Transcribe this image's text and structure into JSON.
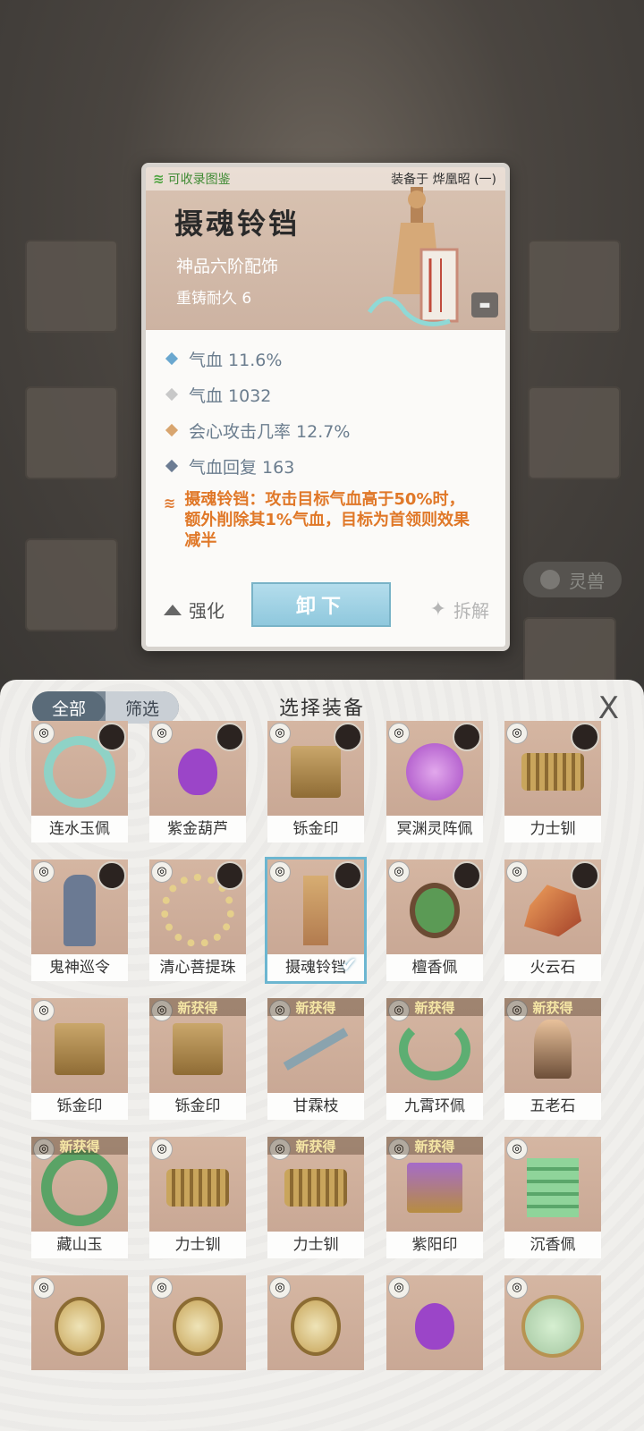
{
  "background": {
    "pill_label": "灵兽"
  },
  "detail": {
    "collect_label": "可收录图鉴",
    "equipped_on": "装备于 烨凰昭 (一)",
    "name": "摄魂铃铛",
    "grade": "神品六阶配饰",
    "durability": "重铸耐久 6",
    "attributes": [
      {
        "text": "气血 11.6%",
        "color": "#6aa7cf"
      },
      {
        "text": "气血 1032",
        "color": "#c8c8c8"
      },
      {
        "text": "会心攻击几率 12.7%",
        "color": "#d8a56f"
      },
      {
        "text": "气血回复 163",
        "color": "#6c7c93"
      }
    ],
    "skill_text": "摄魂铃铛：攻击目标气血高于50%时，额外削除其1%气血，目标为首领则效果减半",
    "strengthen_label": "强化",
    "unequip_label": "卸下",
    "dismantle_label": "拆解"
  },
  "panel": {
    "title": "选择装备",
    "filter_all": "全部",
    "filter_screen": "筛选",
    "close": "X"
  },
  "items": [
    {
      "name": "连水玉佩",
      "art": "ring",
      "avatar": true,
      "new": false
    },
    {
      "name": "紫金葫芦",
      "art": "gourd",
      "avatar": true,
      "new": false
    },
    {
      "name": "铄金印",
      "art": "seal",
      "avatar": true,
      "new": false
    },
    {
      "name": "冥渊灵阵佩",
      "art": "disk",
      "avatar": true,
      "new": false
    },
    {
      "name": "力士钏",
      "art": "coil",
      "avatar": true,
      "new": false
    },
    {
      "name": "鬼神巡令",
      "art": "token",
      "avatar": true,
      "new": false
    },
    {
      "name": "清心菩提珠",
      "art": "beads",
      "avatar": true,
      "new": false
    },
    {
      "name": "摄魂铃铛",
      "art": "bell",
      "avatar": true,
      "new": false,
      "selected": true
    },
    {
      "name": "檀香佩",
      "art": "pendant",
      "avatar": true,
      "new": false
    },
    {
      "name": "火云石",
      "art": "rock",
      "avatar": true,
      "new": false
    },
    {
      "name": "铄金印",
      "art": "seal",
      "avatar": false,
      "new": false
    },
    {
      "name": "铄金印",
      "art": "seal",
      "avatar": false,
      "new": true
    },
    {
      "name": "甘霖枝",
      "art": "branch",
      "avatar": false,
      "new": true
    },
    {
      "name": "九霄环佩",
      "art": "collar",
      "avatar": false,
      "new": true
    },
    {
      "name": "五老石",
      "art": "stone5",
      "avatar": false,
      "new": true
    },
    {
      "name": "藏山玉",
      "art": "jade",
      "avatar": false,
      "new": true
    },
    {
      "name": "力士钏",
      "art": "coil",
      "avatar": false,
      "new": false
    },
    {
      "name": "力士钏",
      "art": "coil",
      "avatar": false,
      "new": true
    },
    {
      "name": "紫阳印",
      "art": "seal2",
      "avatar": false,
      "new": true
    },
    {
      "name": "沉香佩",
      "art": "green-pend",
      "avatar": false,
      "new": false
    },
    {
      "name": "",
      "art": "mirror",
      "avatar": false,
      "new": false
    },
    {
      "name": "",
      "art": "mirror",
      "avatar": false,
      "new": false
    },
    {
      "name": "",
      "art": "mirror",
      "avatar": false,
      "new": false
    },
    {
      "name": "",
      "art": "gourd",
      "avatar": false,
      "new": false
    },
    {
      "name": "",
      "art": "disk2",
      "avatar": false,
      "new": false
    }
  ],
  "new_badge": "新获得"
}
